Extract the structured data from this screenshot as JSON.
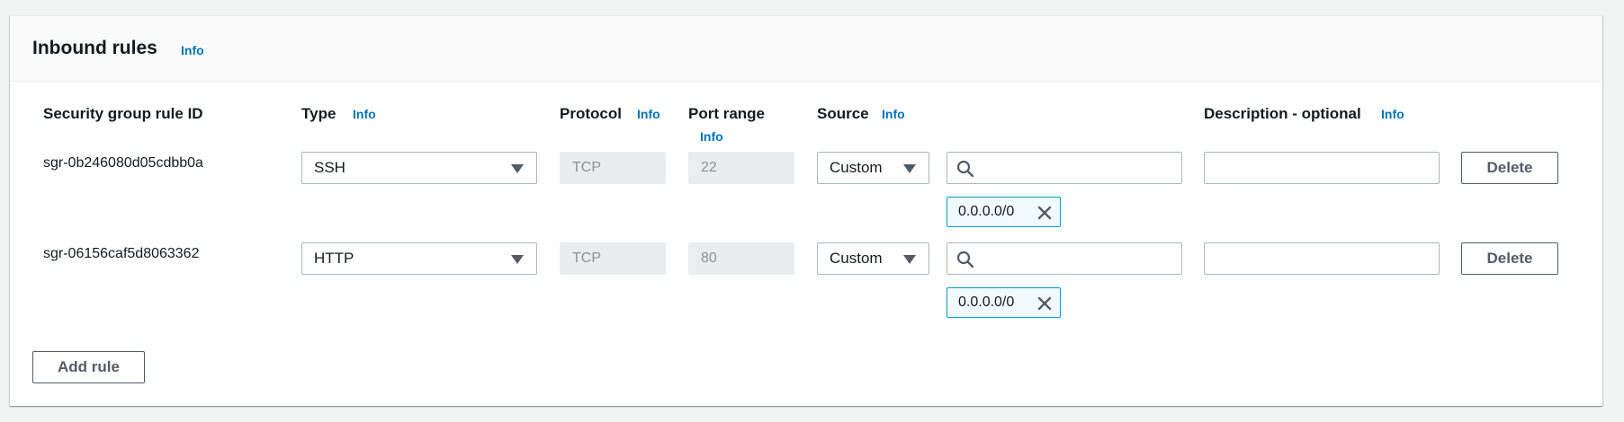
{
  "section": {
    "title": "Inbound rules",
    "info_label": "Info"
  },
  "columns": {
    "rule_id": "Security group rule ID",
    "type": "Type",
    "protocol": "Protocol",
    "port_range": "Port range",
    "source": "Source",
    "description": "Description - optional",
    "info_label": "Info"
  },
  "rules": [
    {
      "rule_id": "sgr-0b246080d05cdbb0a",
      "type": "SSH",
      "protocol": "TCP",
      "port_range": "22",
      "source_type": "Custom",
      "source_search": "",
      "source_token": "0.0.0.0/0",
      "description": "",
      "delete_label": "Delete"
    },
    {
      "rule_id": "sgr-06156caf5d8063362",
      "type": "HTTP",
      "protocol": "TCP",
      "port_range": "80",
      "source_type": "Custom",
      "source_search": "",
      "source_token": "0.0.0.0/0",
      "description": "",
      "delete_label": "Delete"
    }
  ],
  "add_rule_label": "Add rule",
  "colors": {
    "link": "#0073bb",
    "token_border": "#00a1c9",
    "readonly_bg": "#eaeded"
  }
}
